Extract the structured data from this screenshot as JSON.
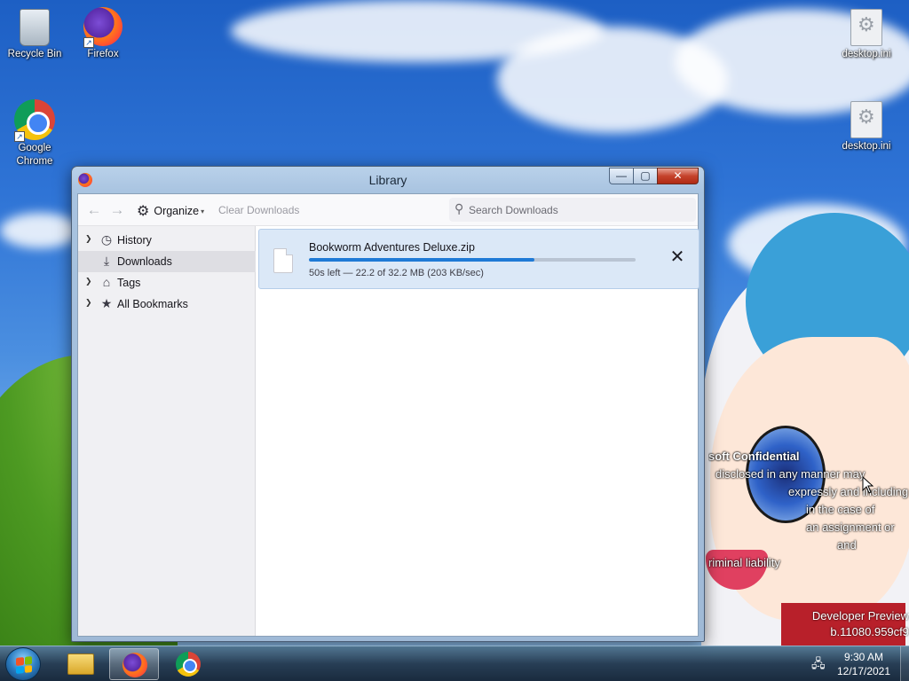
{
  "desktop": {
    "icons": [
      {
        "label": "Recycle Bin"
      },
      {
        "label": "Firefox"
      },
      {
        "label": "Google Chrome"
      },
      {
        "label": "desktop.ini"
      },
      {
        "label": "desktop.ini"
      }
    ],
    "watermark": {
      "title": "soft Confidential",
      "lines": [
        "disclosed in any manner may",
        "expressly and including",
        "in the case of",
        "an assignment or",
        "and",
        "riminal liability"
      ],
      "build_line1": "Developer Preview",
      "build_line2": "b.11080.959cf9"
    }
  },
  "window": {
    "title": "Library",
    "buttons": {
      "minimize": "—",
      "maximize": "▢",
      "close": "✕"
    },
    "toolbar": {
      "back": "←",
      "forward": "→",
      "organize": "Organize",
      "clear_downloads": "Clear Downloads",
      "search_placeholder": "Search Downloads"
    },
    "sidebar": [
      {
        "label": "History",
        "icon": "clock-icon",
        "expandable": true
      },
      {
        "label": "Downloads",
        "icon": "download-icon",
        "expandable": false,
        "selected": true
      },
      {
        "label": "Tags",
        "icon": "tag-icon",
        "expandable": true
      },
      {
        "label": "All Bookmarks",
        "icon": "star-icon",
        "expandable": true
      }
    ],
    "downloads": [
      {
        "filename": "Bookworm Adventures Deluxe.zip",
        "status": "50s left — 22.2 of 32.2 MB (203 KB/sec)",
        "progress": 0.69
      }
    ]
  },
  "taskbar": {
    "clock_time": "9:30 AM",
    "clock_date": "12/17/2021"
  },
  "colors": {
    "accent": "#1f7ad6",
    "selection": "#dbe8f7"
  }
}
